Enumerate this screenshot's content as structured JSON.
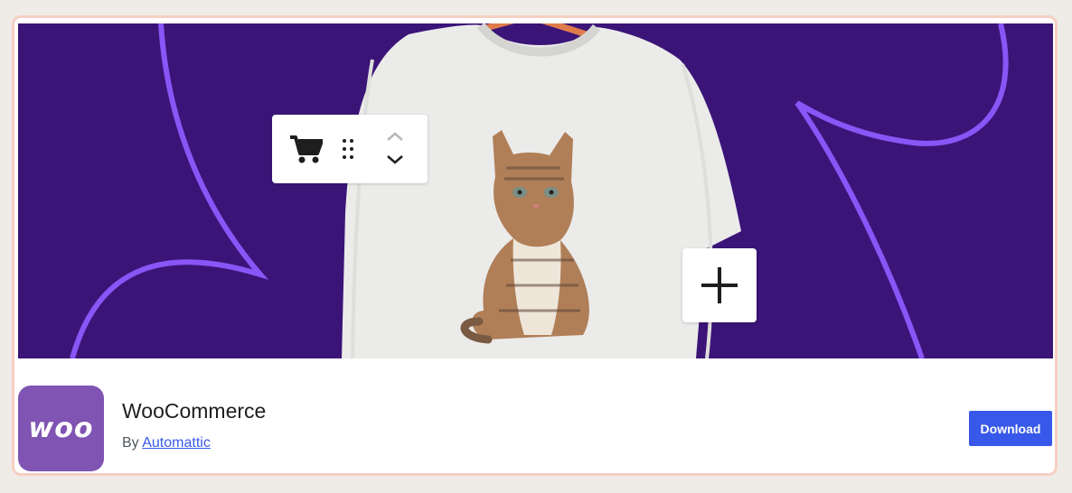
{
  "plugin": {
    "name": "WooCommerce",
    "author_prefix": "By",
    "author_name": "Automattic",
    "logo_text": "woo",
    "download_label": "Download"
  },
  "banner": {
    "background_color": "#3b1478",
    "accent_color": "#8a55f6",
    "image_subject": "white sweatshirt with kitten print on hanger",
    "toolbar_icons": [
      "cart-icon",
      "drag-handle-icon",
      "move-up-icon",
      "move-down-icon"
    ],
    "add_block_icon": "plus-icon"
  },
  "colors": {
    "download_button": "#3858e9",
    "logo_background": "#7f54b3",
    "card_border": "#f6cfc2"
  }
}
